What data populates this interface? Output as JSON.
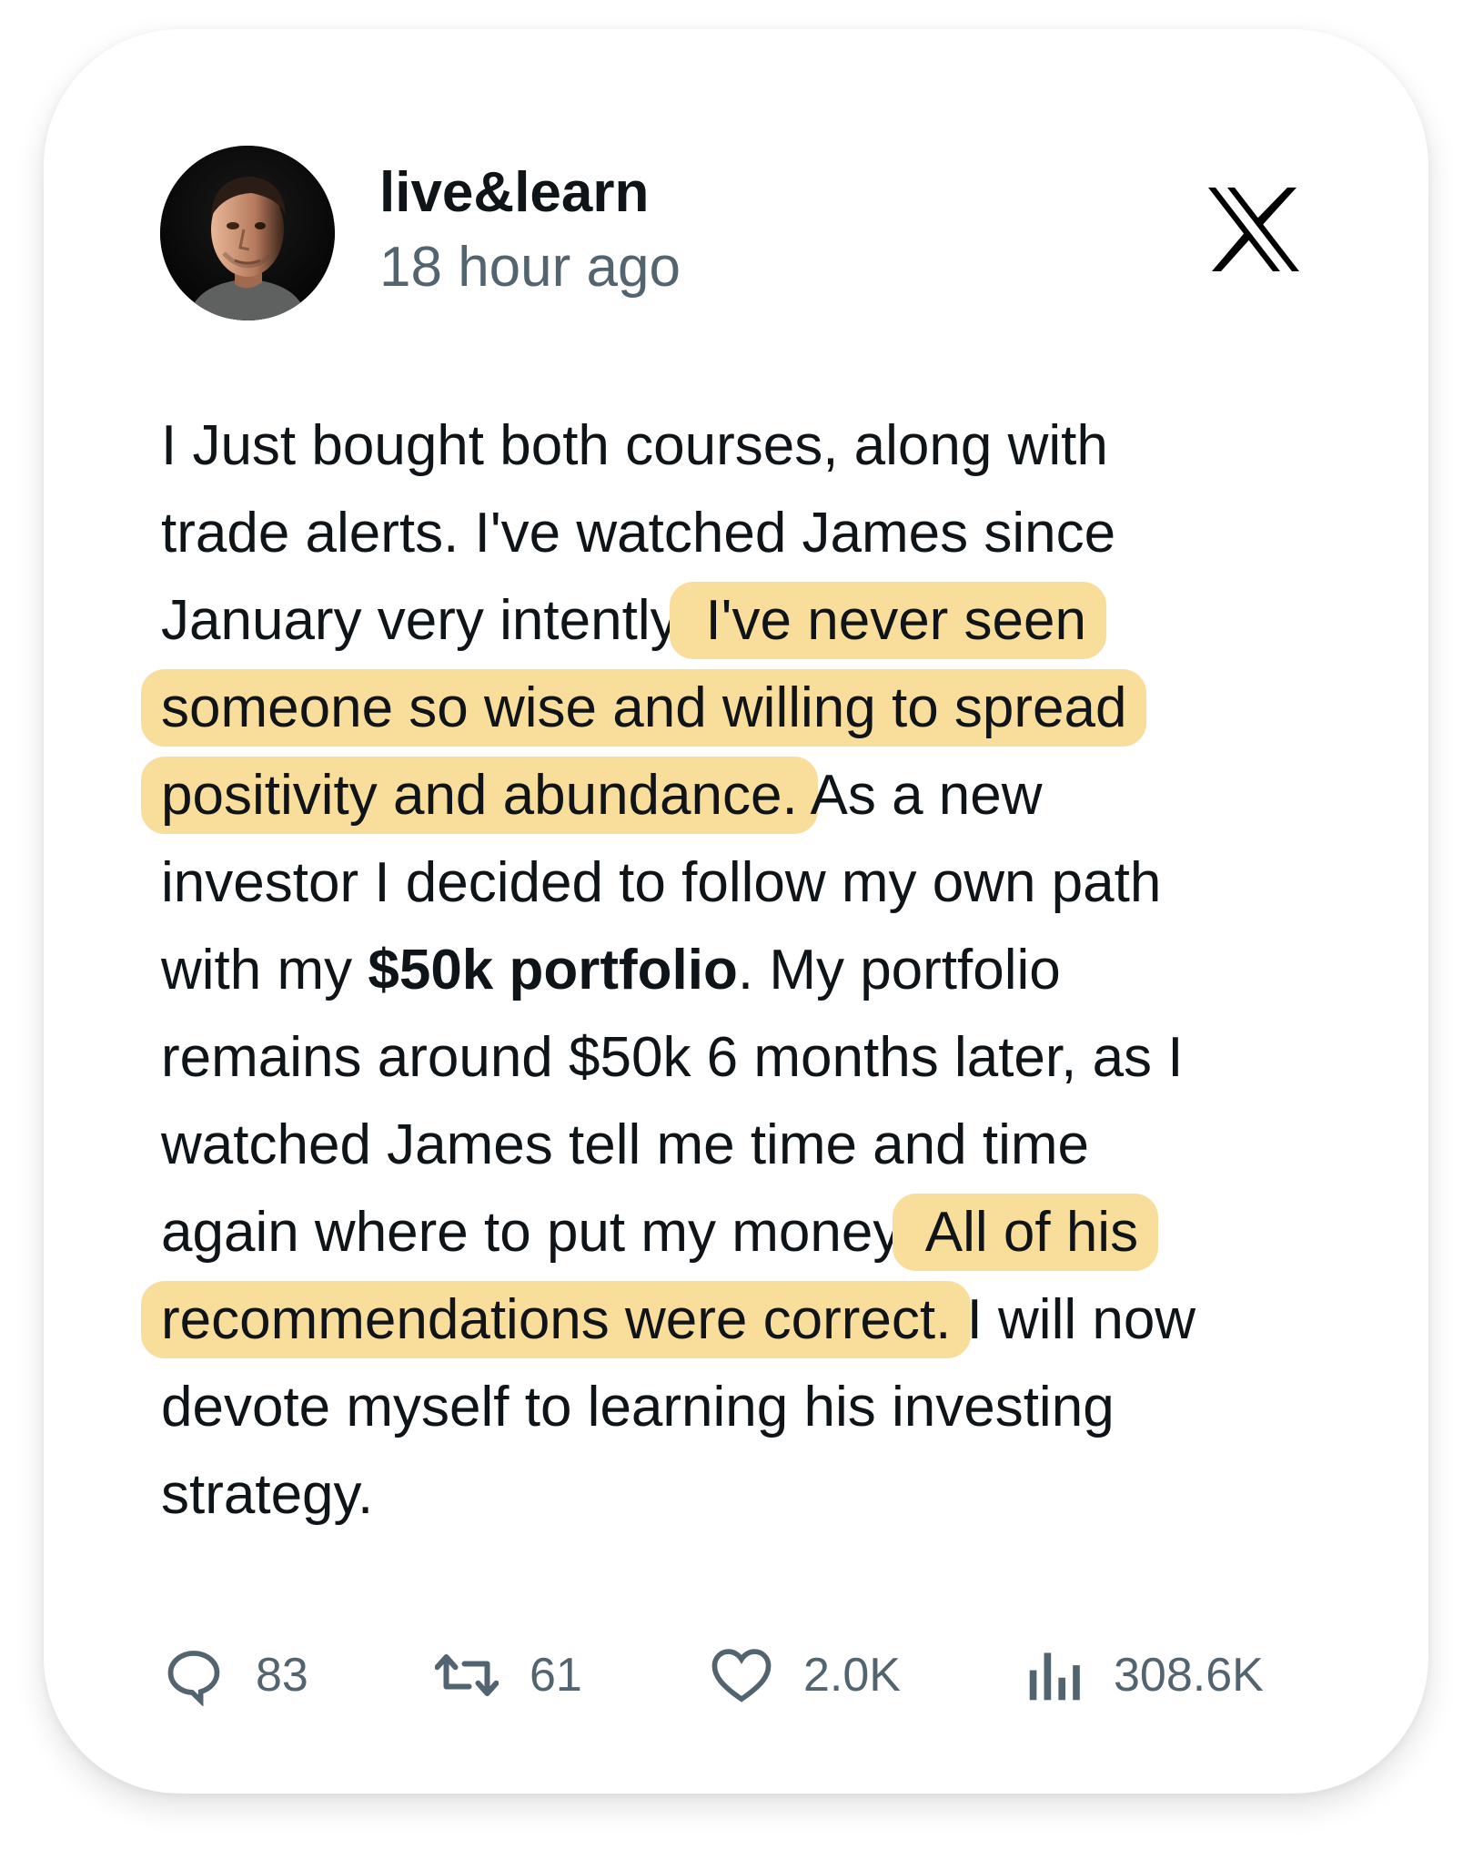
{
  "post": {
    "username": "live&learn",
    "timestamp": "18 hour ago",
    "platform_icon": "x-logo-icon",
    "lines": [
      [
        {
          "text": "I Just bought both courses, along with"
        }
      ],
      [
        {
          "text": "trade alerts. I've watched James since"
        }
      ],
      [
        {
          "text": "January very intently."
        },
        {
          "text": " I've never seen",
          "highlight": true
        }
      ],
      [
        {
          "text": "someone so wise and willing to spread",
          "highlight": true
        }
      ],
      [
        {
          "text": "positivity and abundance.",
          "highlight": true
        },
        {
          "text": " As a new"
        }
      ],
      [
        {
          "text": "investor I decided to follow my own path"
        }
      ],
      [
        {
          "text": "with my "
        },
        {
          "text": "$50k portfolio",
          "bold": true
        },
        {
          "text": ". My portfolio"
        }
      ],
      [
        {
          "text": "remains around $50k 6 months later, as I"
        }
      ],
      [
        {
          "text": "watched James tell me time and time"
        }
      ],
      [
        {
          "text": "again where to put my money."
        },
        {
          "text": " All of his",
          "highlight": true
        }
      ],
      [
        {
          "text": "recommendations were correct.",
          "highlight": true
        },
        {
          "text": " I will now"
        }
      ],
      [
        {
          "text": "devote myself to learning his investing"
        }
      ],
      [
        {
          "text": "strategy."
        }
      ]
    ],
    "highlight_color": "#f9dd9b"
  },
  "actions": {
    "reply": {
      "icon": "reply-icon",
      "count": "83"
    },
    "repost": {
      "icon": "repost-icon",
      "count": "61"
    },
    "like": {
      "icon": "heart-icon",
      "count": "2.0K"
    },
    "views": {
      "icon": "views-icon",
      "count": "308.6K"
    }
  },
  "colors": {
    "text": "#0f1419",
    "secondary": "#536471",
    "card_background": "#ffffff"
  }
}
